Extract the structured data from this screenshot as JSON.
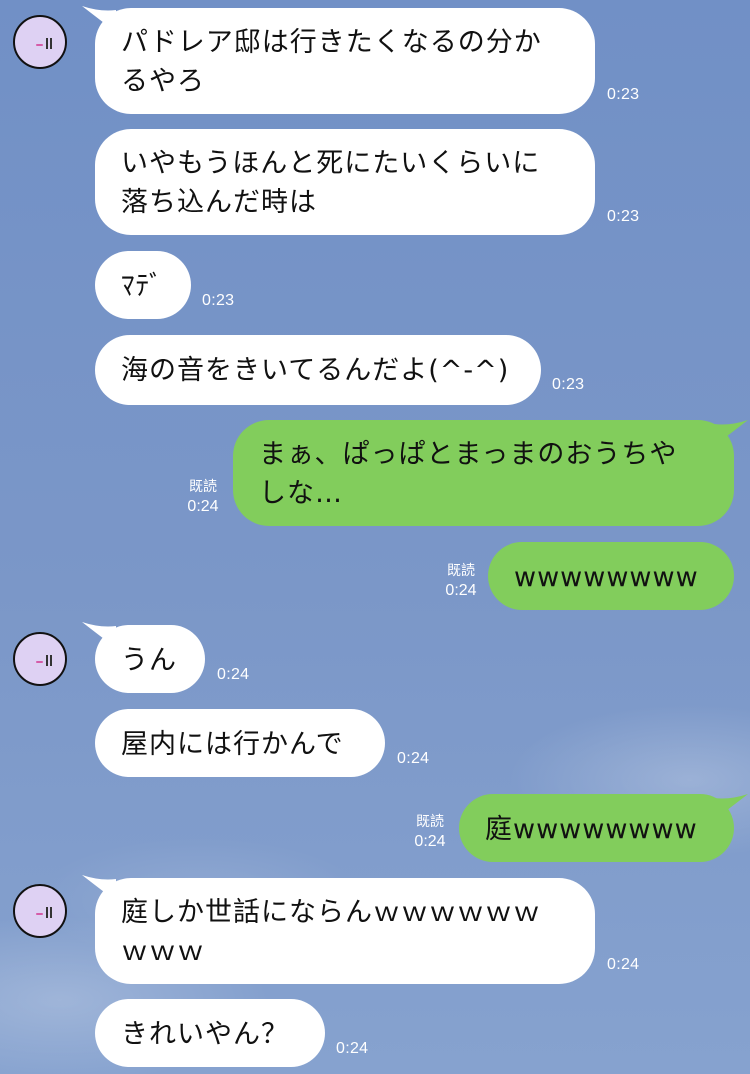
{
  "messages": [
    {
      "side": "in",
      "avatar": true,
      "text": "パドレア邸は行きたくなるの分か\nるやろ",
      "time": "0:23"
    },
    {
      "side": "in",
      "avatar": false,
      "text": "いやもうほんと死にたいくらいに\n落ち込んだ時は",
      "time": "0:23"
    },
    {
      "side": "in",
      "avatar": false,
      "text": "ﾏﾃﾞ",
      "time": "0:23"
    },
    {
      "side": "in",
      "avatar": false,
      "text": "海の音をきいてるんだよ(^-^)",
      "time": "0:23"
    },
    {
      "side": "out",
      "read": "既読",
      "text": "まぁ、ぱっぱとまっまのおうちや\nしな…",
      "time": "0:24"
    },
    {
      "side": "out",
      "read": "既読",
      "text": "wwwwwwww",
      "time": "0:24"
    },
    {
      "side": "in",
      "avatar": true,
      "text": "うん",
      "time": "0:24"
    },
    {
      "side": "in",
      "avatar": false,
      "text": "屋内には行かんで",
      "time": "0:24"
    },
    {
      "side": "out",
      "read": "既読",
      "text": "庭wwwwwwww",
      "time": "0:24"
    },
    {
      "side": "in",
      "avatar": true,
      "text": "庭しか世話にならんｗｗｗｗｗｗ\nｗｗｗ",
      "time": "0:24"
    },
    {
      "side": "in",
      "avatar": false,
      "text": "きれいやん？",
      "time": "0:24"
    }
  ],
  "colors": {
    "incoming": "#ffffff",
    "outgoing": "#82cd5c",
    "background": "#7592c4"
  },
  "icons": {
    "avatar": "contact-avatar-face"
  }
}
